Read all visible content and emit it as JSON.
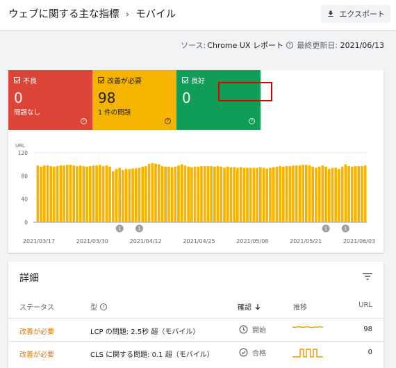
{
  "header": {
    "breadcrumb_parent": "ウェブに関する主な指標",
    "breadcrumb_sep": "›",
    "breadcrumb_current": "モバイル",
    "export_label": "エクスポート"
  },
  "meta": {
    "source_label": "ソース:",
    "source_value": "Chrome UX レポート",
    "updated_label": "最終更新日:",
    "updated_value": "2021/06/13"
  },
  "tiles": [
    {
      "label": "不良",
      "count": "0",
      "sub": "問題なし"
    },
    {
      "label": "改善が必要",
      "count": "98",
      "sub": "1 件の問題"
    },
    {
      "label": "良好",
      "count": "0",
      "sub": ""
    }
  ],
  "chart_data": {
    "type": "bar",
    "ylabel": "URL",
    "ylim": [
      0,
      120
    ],
    "yticks": [
      0,
      40,
      80,
      120
    ],
    "xtick_labels": [
      "2021/03/17",
      "2021/03/30",
      "2021/04/12",
      "2021/04/25",
      "2021/05/08",
      "2021/05/21",
      "2021/06/03"
    ],
    "color": "#f4b400",
    "values": [
      98,
      96,
      98,
      98,
      97,
      96,
      97,
      98,
      98,
      99,
      99,
      98,
      97,
      98,
      97,
      96,
      97,
      98,
      98,
      99,
      97,
      98,
      96,
      88,
      92,
      94,
      90,
      92,
      92,
      93,
      93,
      94,
      96,
      97,
      101,
      102,
      101,
      100,
      97,
      96,
      96,
      95,
      96,
      98,
      100,
      98,
      96,
      95,
      96,
      96,
      97,
      97,
      97,
      97,
      96,
      97,
      96,
      94,
      96,
      95,
      95,
      94,
      95,
      94,
      94,
      94,
      94,
      94,
      95,
      94,
      93,
      94,
      95,
      96,
      97,
      96,
      97,
      97,
      98,
      98,
      98,
      99,
      99,
      98,
      96,
      94,
      96,
      98,
      96,
      92,
      94,
      94,
      92,
      96,
      100,
      97,
      96,
      97,
      97,
      97,
      98
    ],
    "annotations": [
      {
        "index": 25,
        "label": "1"
      },
      {
        "index": 31,
        "label": "1"
      },
      {
        "index": 88,
        "label": "1"
      },
      {
        "index": 94,
        "label": "1"
      }
    ]
  },
  "details": {
    "title": "詳細",
    "columns": {
      "status": "ステータス",
      "type": "型",
      "validation": "確認",
      "trend": "推移",
      "url": "URL"
    },
    "rows": [
      {
        "status": "改善が必要",
        "type": "LCP の問題: 2.5秒 超（モバイル）",
        "validation": "開始",
        "validation_icon": "clock-icon",
        "urls": "98"
      },
      {
        "status": "改善が必要",
        "type": "CLS に関する問題: 0.1 超（モバイル）",
        "validation": "合格",
        "validation_icon": "check-circle-icon",
        "urls": "0"
      }
    ]
  },
  "colors": {
    "poor": "#db4437",
    "needs_improvement": "#f4b400",
    "good": "#0f9d58",
    "status_text": "#e37400",
    "highlight": "#e00000"
  }
}
